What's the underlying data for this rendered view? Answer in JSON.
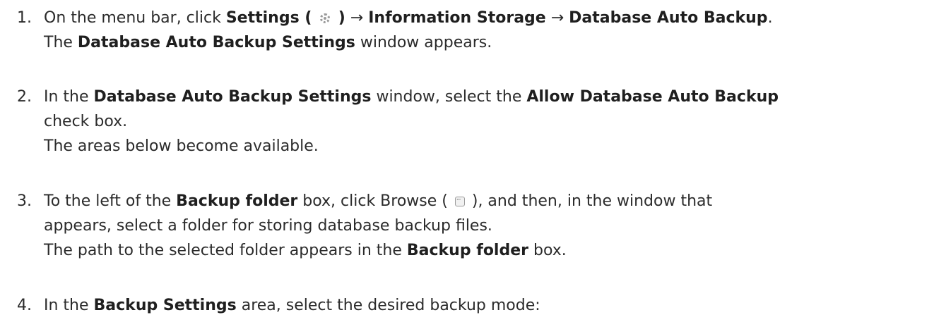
{
  "steps": [
    {
      "number": "1.",
      "line1": {
        "t1": "On the menu bar, click ",
        "b1": "Settings (",
        "b2": ")",
        "arrow1": " → ",
        "b3": "Information Storage",
        "arrow2": " → ",
        "b4": "Database Auto Backup",
        "t2": "."
      },
      "line2": {
        "t1": "The ",
        "b1": "Database Auto Backup Settings",
        "t2": " window appears."
      },
      "icon": "gear-icon"
    },
    {
      "number": "2.",
      "line1": {
        "t1": "In the ",
        "b1": "Database Auto Backup Settings",
        "t2": " window, select the ",
        "b2": "Allow Database Auto Backup"
      },
      "line2": "check box.",
      "line3": "The areas below become available."
    },
    {
      "number": "3.",
      "line1": {
        "t1": "To the left of the ",
        "b1": "Backup folder",
        "t2": " box, click Browse (",
        "t3": "), and then, in the window that"
      },
      "line2": "appears, select a folder for storing database backup files.",
      "line3": {
        "t1": "The path to the selected folder appears in the ",
        "b1": "Backup folder",
        "t2": " box."
      },
      "icon": "browse-icon"
    },
    {
      "number": "4.",
      "line1": {
        "t1": "In the ",
        "b1": "Backup Settings",
        "t2": " area, select the desired backup mode:"
      }
    }
  ]
}
